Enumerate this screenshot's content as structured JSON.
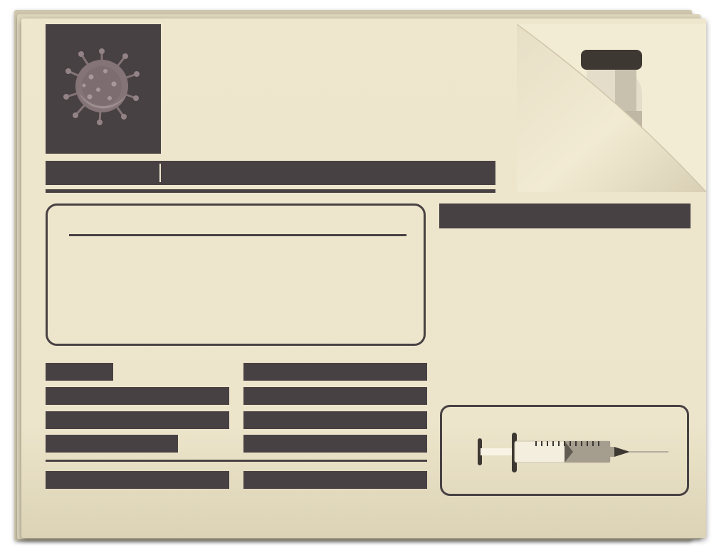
{
  "illustration": {
    "theme": "newspaper-vaccine-infographic",
    "icons": [
      "virus-icon",
      "vaccine-vial-icon",
      "syringe-icon"
    ],
    "colors": {
      "paper": "#efe7cd",
      "ink": "#484143",
      "virus": "#847477",
      "vial_cap": "#3e3833",
      "syringe_plunger": "#3e3833"
    }
  }
}
